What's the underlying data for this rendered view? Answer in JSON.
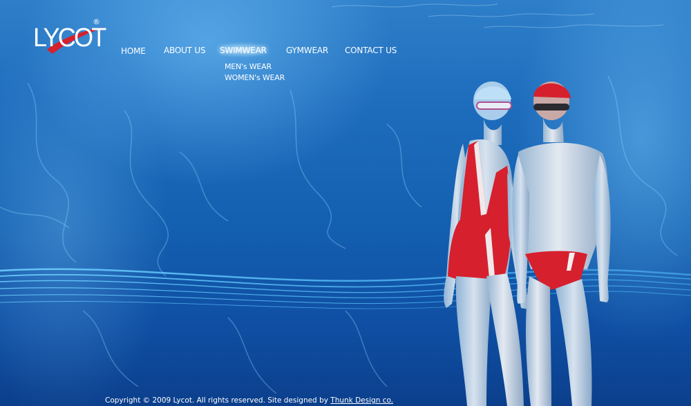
{
  "brand": {
    "logo_text": "LYCOT",
    "registered_mark": "®"
  },
  "nav": {
    "items": [
      {
        "label": "HOME"
      },
      {
        "label": "ABOUT US"
      },
      {
        "label": "SWIMWEAR"
      },
      {
        "label": "GYMWEAR"
      },
      {
        "label": "CONTACT US"
      }
    ],
    "active": "SWIMWEAR",
    "submenu": [
      {
        "label": "MEN's WEAR"
      },
      {
        "label": "WOMEN's WEAR"
      }
    ]
  },
  "footer": {
    "copyright": "Copyright © 2009 Lycot. All rights reserved. Site designed by",
    "designer_link": "Thunk Design co."
  },
  "colors": {
    "water_top": "#2e7fc9",
    "water_bottom": "#0b3f8c",
    "swimsuit_red": "#d6202e",
    "text": "#ffffff"
  }
}
